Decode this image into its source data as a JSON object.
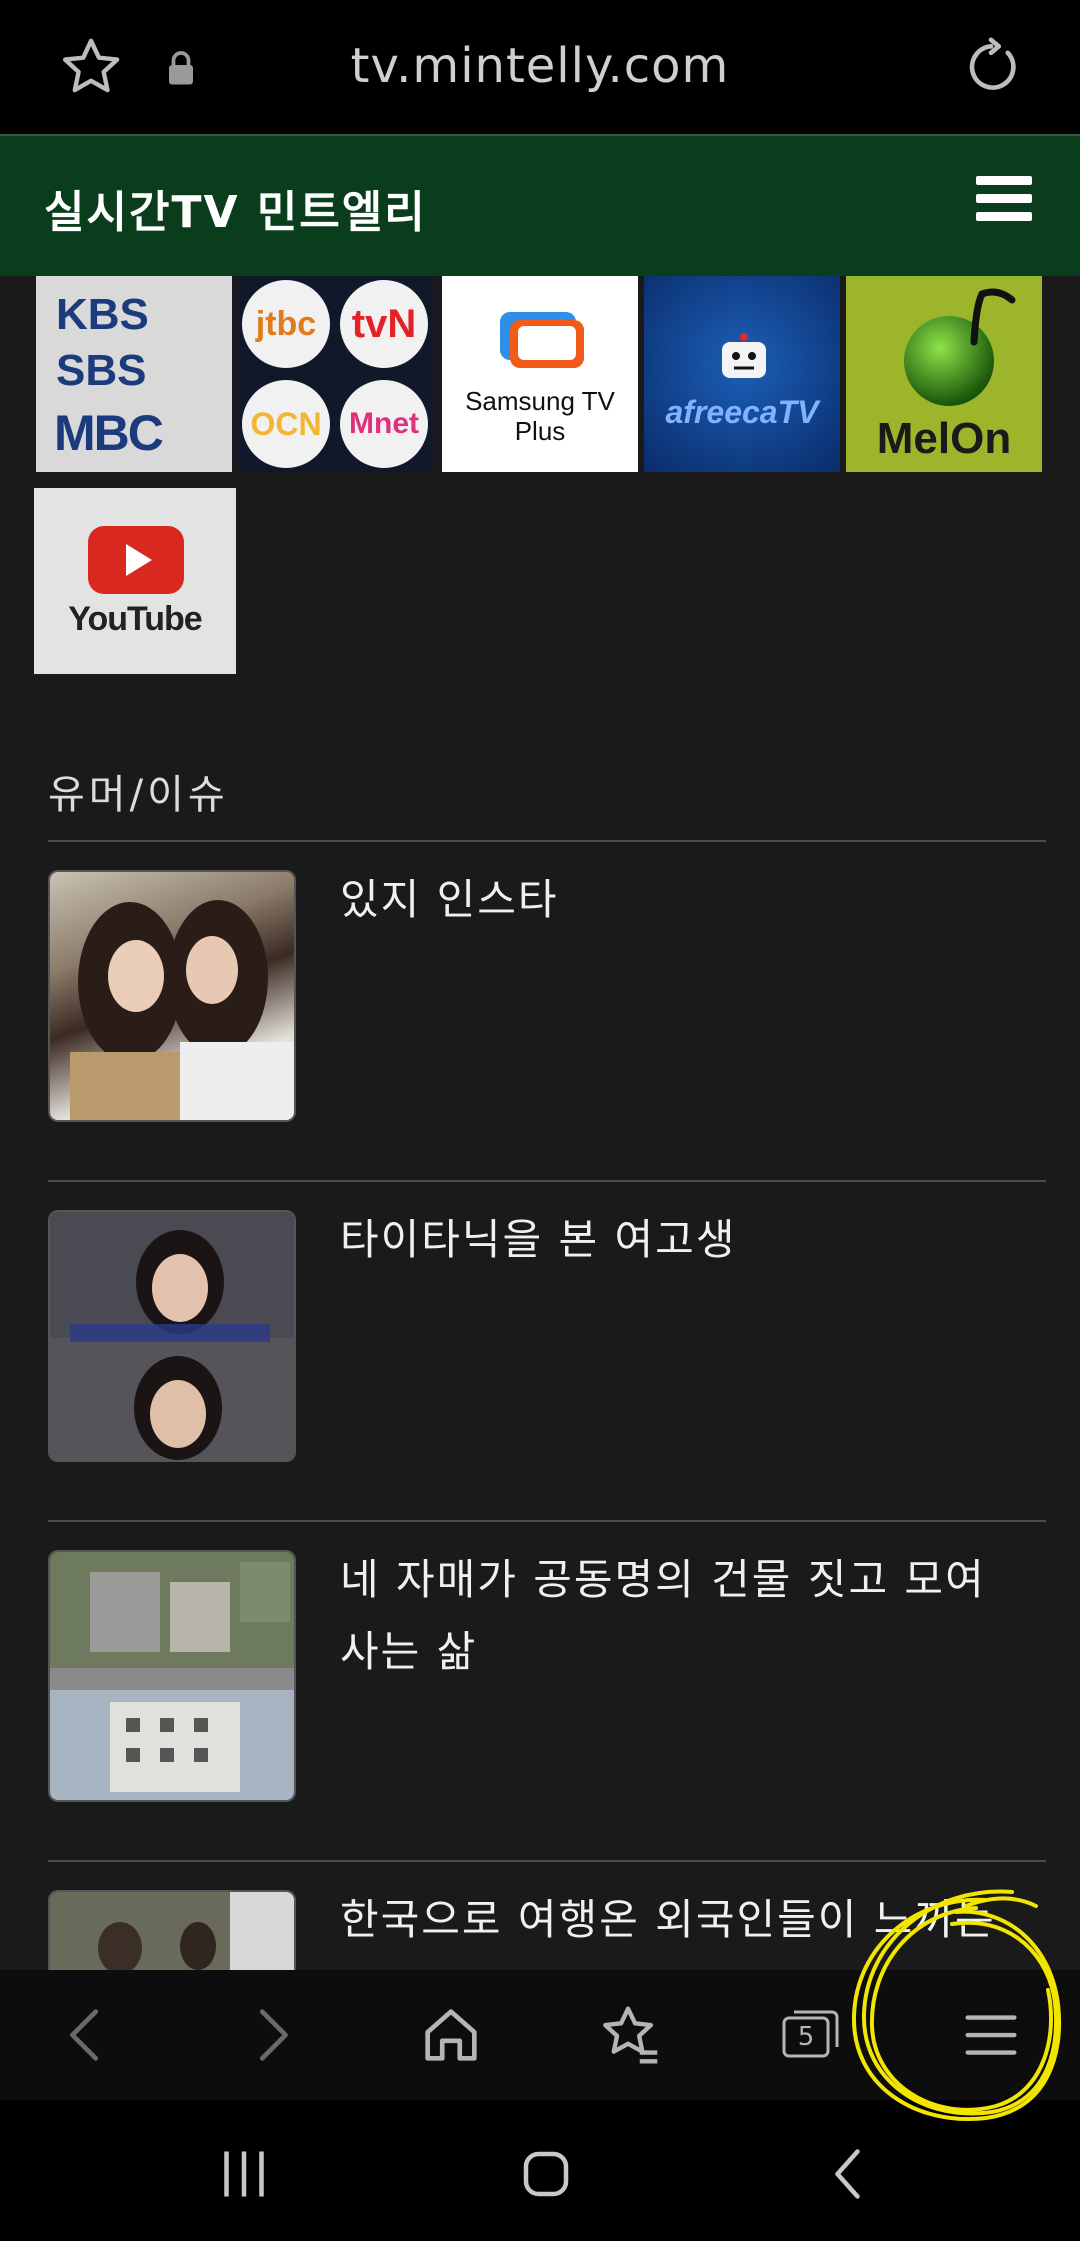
{
  "browser": {
    "url": "tv.mintelly.com",
    "tab_count": "5"
  },
  "site": {
    "title": "실시간TV 민트엘리"
  },
  "channels": {
    "broadcast": {
      "kbs": "KBS",
      "sbs": "SBS",
      "mbc": "MBC"
    },
    "cable": {
      "jtbc": "jtbc",
      "tvn": "tvN",
      "ocn": "OCN",
      "mnet": "Mnet"
    },
    "samsung": {
      "label": "Samsung TV Plus"
    },
    "afreeca": {
      "label": "afreecaTV"
    },
    "melon": {
      "label": "MelOn"
    },
    "youtube": {
      "label": "YouTube"
    }
  },
  "section": {
    "title": "유머/이슈",
    "items": [
      {
        "title": "있지 인스타"
      },
      {
        "title": "타이타닉을 본 여고생"
      },
      {
        "title": "네 자매가 공동명의 건물 짓고 모여 사는 삶"
      },
      {
        "title": "한국으로 여행온 외국인들이 느끼는"
      }
    ]
  },
  "colors": {
    "header_green": "#0a3d1b",
    "background": "#1a1a1a",
    "annotation_yellow": "#f2e600"
  }
}
